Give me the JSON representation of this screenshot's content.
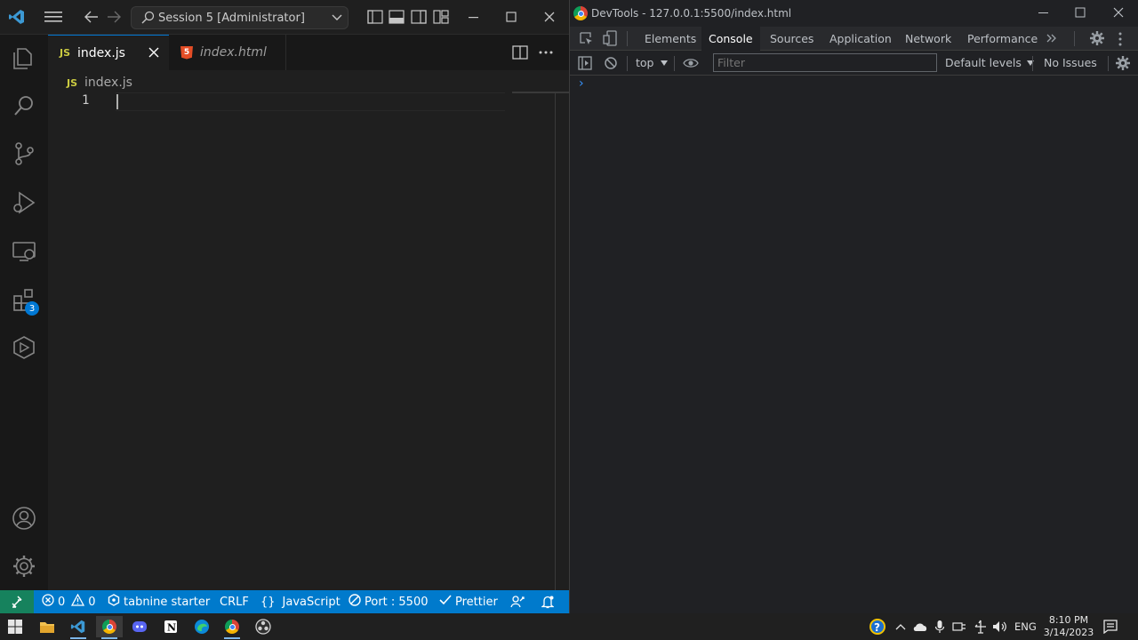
{
  "vscode": {
    "command_center": "Session 5 [Administrator]",
    "tabs": [
      {
        "label": "index.js",
        "badge": "JS",
        "active": true
      },
      {
        "label": "index.html",
        "badge": "5",
        "active": false
      }
    ],
    "breadcrumb": {
      "badge": "JS",
      "file": "index.js"
    },
    "editor": {
      "line_numbers": [
        "1"
      ]
    },
    "activity_badge": "3",
    "statusbar": {
      "errors": "0",
      "warnings": "0",
      "tabnine": "tabnine starter",
      "eol": "CRLF",
      "language": "JavaScript",
      "port": "Port : 5500",
      "prettier": "Prettier"
    }
  },
  "devtools": {
    "title": "DevTools - 127.0.0.1:5500/index.html",
    "tabs": [
      "Elements",
      "Console",
      "Sources",
      "Application",
      "Network",
      "Performance"
    ],
    "active_tab": "Console",
    "context": "top",
    "filter_placeholder": "Filter",
    "levels": "Default levels",
    "issues": "No Issues",
    "prompt": "›"
  },
  "taskbar": {
    "time": "8:10 PM",
    "date": "3/14/2023",
    "lang": "ENG"
  },
  "colors": {
    "statusbar": "#007acc",
    "accent_blue": "#3794ff",
    "js_yellow": "#cbcb41",
    "html_orange": "#e44d26"
  }
}
